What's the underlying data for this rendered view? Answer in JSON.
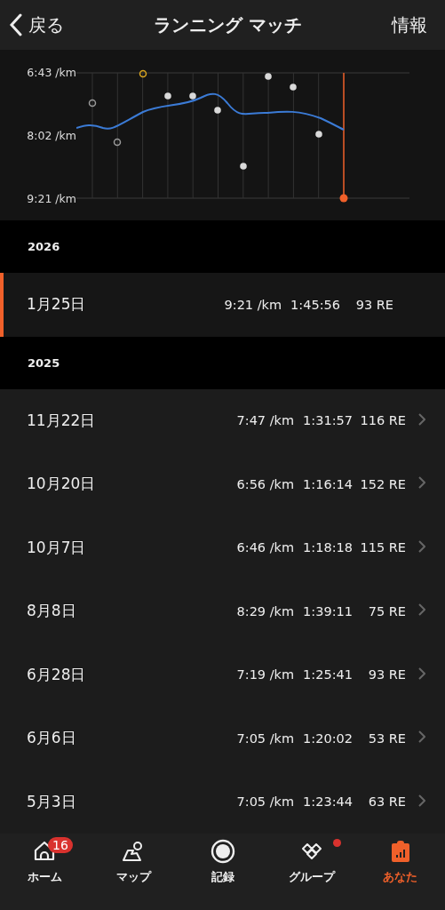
{
  "header": {
    "back": "戻る",
    "title": "ランニング マッチ",
    "info": "情報"
  },
  "chart": {
    "y_axis_labels": [
      "6:43 /km",
      "8:02 /km",
      "9:21 /km"
    ]
  },
  "sections": [
    {
      "year": "2026",
      "rows": [
        {
          "date": "1月25日",
          "pace": "9:21 /km",
          "time": "1:45:56",
          "re": "93 RE",
          "selected": true
        }
      ]
    },
    {
      "year": "2025",
      "rows": [
        {
          "date": "11月22日",
          "pace": "7:47 /km",
          "time": "1:31:57",
          "re": "116 RE",
          "selected": false
        },
        {
          "date": "10月20日",
          "pace": "6:56 /km",
          "time": "1:16:14",
          "re": "152 RE",
          "selected": false
        },
        {
          "date": "10月7日",
          "pace": "6:46 /km",
          "time": "1:18:18",
          "re": "115 RE",
          "selected": false
        },
        {
          "date": "8月8日",
          "pace": "8:29 /km",
          "time": "1:39:11",
          "re": "75 RE",
          "selected": false
        },
        {
          "date": "6月28日",
          "pace": "7:19 /km",
          "time": "1:25:41",
          "re": "93 RE",
          "selected": false
        },
        {
          "date": "6月6日",
          "pace": "7:05 /km",
          "time": "1:20:02",
          "re": "53 RE",
          "selected": false
        },
        {
          "date": "5月3日",
          "pace": "7:05 /km",
          "time": "1:23:44",
          "re": "63 RE",
          "selected": false
        }
      ]
    }
  ],
  "tabbar": [
    {
      "kind": "home",
      "label": "ホーム",
      "badge": "16",
      "selected": false
    },
    {
      "kind": "map",
      "label": "マップ",
      "selected": false
    },
    {
      "kind": "record",
      "label": "記録",
      "selected": false
    },
    {
      "kind": "group",
      "label": "グループ",
      "dot": true,
      "selected": false
    },
    {
      "kind": "you",
      "label": "あなた",
      "selected": true
    }
  ]
}
